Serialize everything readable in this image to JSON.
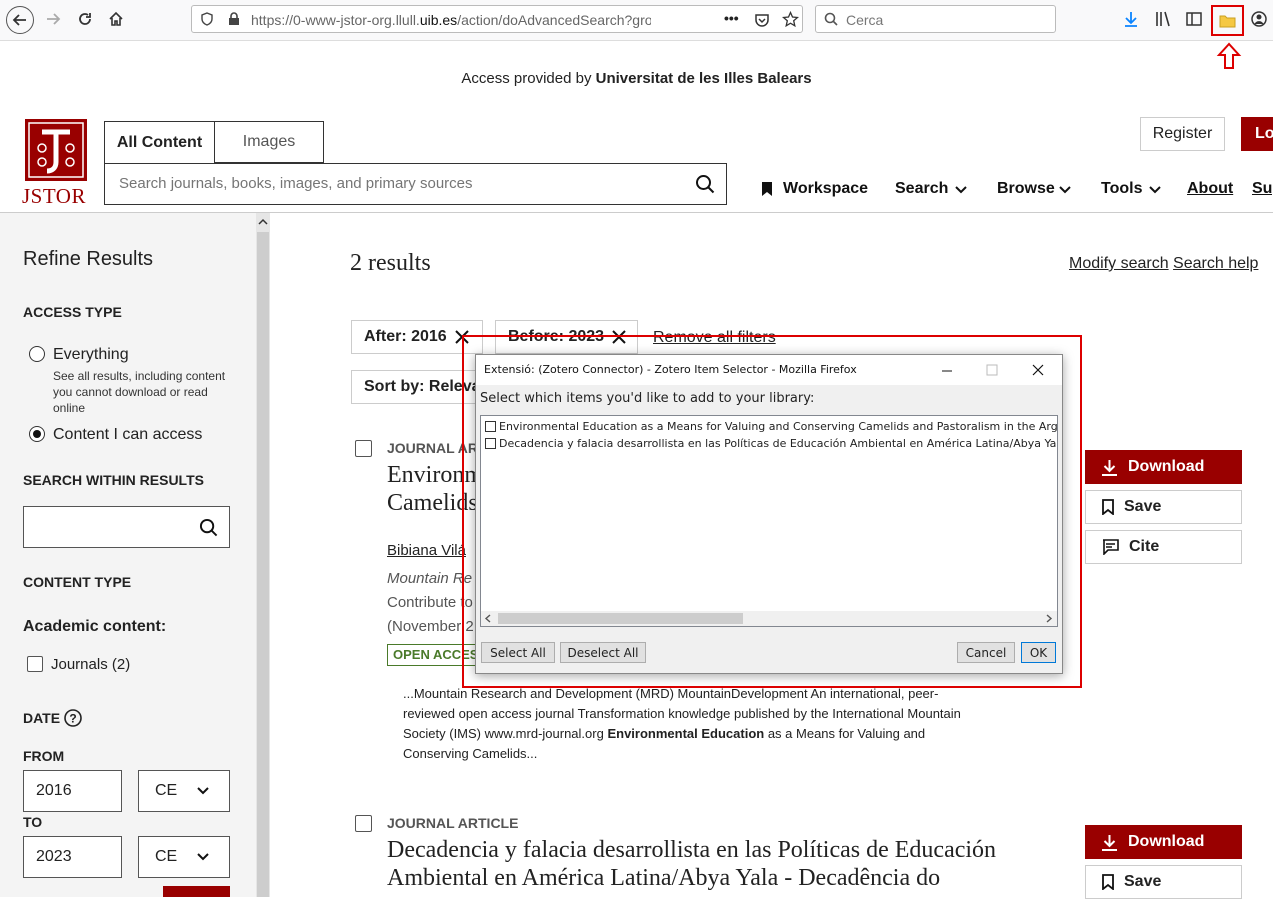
{
  "browser": {
    "url_prefix": "https://0-www-jstor-org.llull.",
    "url_domain": "uib.es",
    "url_path": "/action/doAdvancedSearch?group=none&...",
    "more": "•••",
    "search_placeholder": "Cerca",
    "zotero_color": "#d00000"
  },
  "access": {
    "prefix": "Access provided by ",
    "institution": "Universitat de les Illes Balears"
  },
  "header": {
    "logo_text": "JSTOR",
    "tabs": [
      "All Content",
      "Images"
    ],
    "search_placeholder": "Search journals, books, images, and primary sources",
    "register": "Register",
    "login": "Log",
    "nav": {
      "workspace": "Workspace",
      "search": "Search",
      "browse": "Browse",
      "tools": "Tools",
      "about": "About",
      "support": "Sup"
    }
  },
  "sidebar": {
    "title": "Refine Results",
    "access_type": "ACCESS TYPE",
    "everything": "Everything",
    "everything_desc": [
      "See all results, including content",
      "you cannot download or read",
      "online"
    ],
    "content_access": "Content I can access",
    "search_within": "SEARCH WITHIN RESULTS",
    "content_type": "CONTENT TYPE",
    "academic": "Academic content:",
    "journals": "Journals (2)",
    "date": "DATE",
    "from": "FROM",
    "from_value": "2016",
    "to": "TO",
    "to_value": "2023",
    "era": "CE"
  },
  "results": {
    "count": "2 results",
    "modify": "Modify search",
    "help": "Search help",
    "filters": [
      "After: 2016",
      "Before: 2023"
    ],
    "remove_all": "Remove all filters",
    "sort": "Sort by: Relevan",
    "items": [
      {
        "type": "JOURNAL ARTI",
        "title_lines": [
          "Environm",
          "Camelids"
        ],
        "author": "Bibiana Vilá",
        "journal": "Mountain Re",
        "contribute": "Contribute to",
        "date": "(November 2",
        "badge": "OPEN ACCES",
        "snippet_lines": [
          "...Mountain Research and Development (MRD) MountainDevelopment An international, peer-",
          "reviewed open access journal Transformation knowledge published by the International Mountain",
          "Society (IMS) www.mrd-journal.org",
          "as a Means for Valuing and",
          "Conserving Camelids..."
        ],
        "snippet_bold": "Environmental Education"
      },
      {
        "type": "JOURNAL ARTICLE",
        "title_lines": [
          "Decadencia y falacia desarrollista en las Políticas de Educación",
          "Ambiental en América Latina/Abya Yala - Decadência do"
        ]
      }
    ],
    "download": "Download",
    "save": "Save",
    "cite": "Cite"
  },
  "dialog": {
    "title": "Extensió: (Zotero Connector) - Zotero Item Selector - Mozilla Firefox",
    "prompt": "Select which items you'd like to add to your library:",
    "items": [
      "Environmental Education as a Means for Valuing and Conserving Camelids and Pastoralism in the Arg",
      "Decadencia y falacia desarrollista en las Políticas de Educación Ambiental en América Latina/Abya Yal"
    ],
    "select_all": "Select All",
    "deselect_all": "Deselect All",
    "cancel": "Cancel",
    "ok": "OK"
  },
  "colors": {
    "accent": "#990000",
    "annotation": "#dd0000",
    "open_access": "#4a7a2a"
  }
}
